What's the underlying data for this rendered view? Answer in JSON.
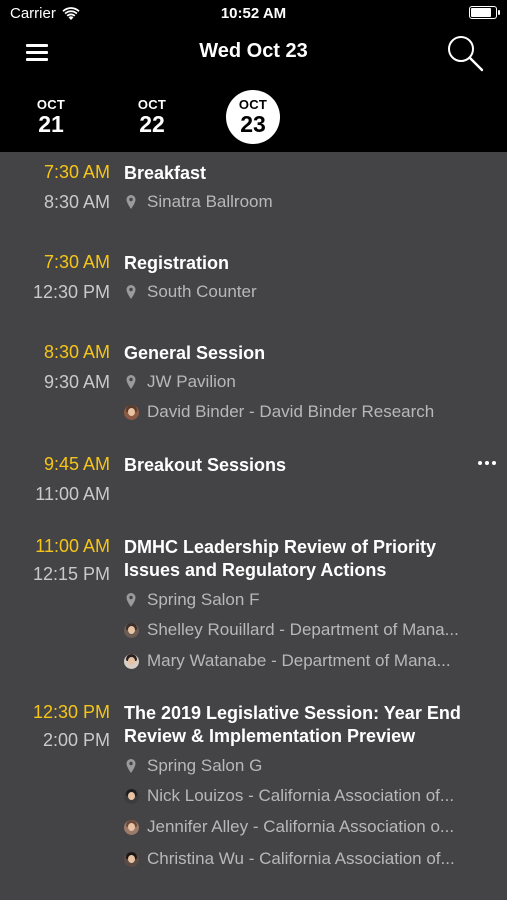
{
  "status_bar": {
    "carrier": "Carrier",
    "time": "10:52 AM",
    "battery_level": 0.9
  },
  "nav": {
    "title": "Wed Oct 23"
  },
  "days": [
    {
      "month": "OCT",
      "day": "21",
      "selected": false
    },
    {
      "month": "OCT",
      "day": "22",
      "selected": false
    },
    {
      "month": "OCT",
      "day": "23",
      "selected": true
    }
  ],
  "sessions": [
    {
      "start": "7:30 AM",
      "end": "8:30 AM",
      "title": "Breakfast",
      "location": "Sinatra Ballroom"
    },
    {
      "start": "7:30 AM",
      "end": "12:30 PM",
      "title": "Registration",
      "location": "South Counter"
    },
    {
      "start": "8:30 AM",
      "end": "9:30 AM",
      "title": "General Session",
      "location": "JW Pavilion",
      "speakers": [
        "David Binder - David Binder Research"
      ]
    },
    {
      "start": "9:45 AM",
      "end": "11:00 AM",
      "title": "Breakout Sessions"
    },
    {
      "start": "11:00 AM",
      "end": "12:15 PM",
      "title_lines": [
        "DMHC Leadership Review of Priority",
        "Issues and Regulatory Actions"
      ],
      "location": "Spring Salon F",
      "speakers": [
        "Shelley Rouillard - Department of Mana...",
        "Mary Watanabe - Department of Mana..."
      ]
    },
    {
      "start": "12:30 PM",
      "end": "2:00 PM",
      "title_lines": [
        "The 2019 Legislative Session: Year End",
        "Review & Implementation Preview"
      ],
      "location": "Spring Salon G",
      "speakers": [
        "Nick Louizos - California Association of...",
        "Jennifer Alley - California Association o...",
        "Christina Wu - California Association of..."
      ]
    }
  ],
  "colors": {
    "accent_time": "#f5c518",
    "header_bg": "#000000",
    "content_bg": "#444446"
  }
}
